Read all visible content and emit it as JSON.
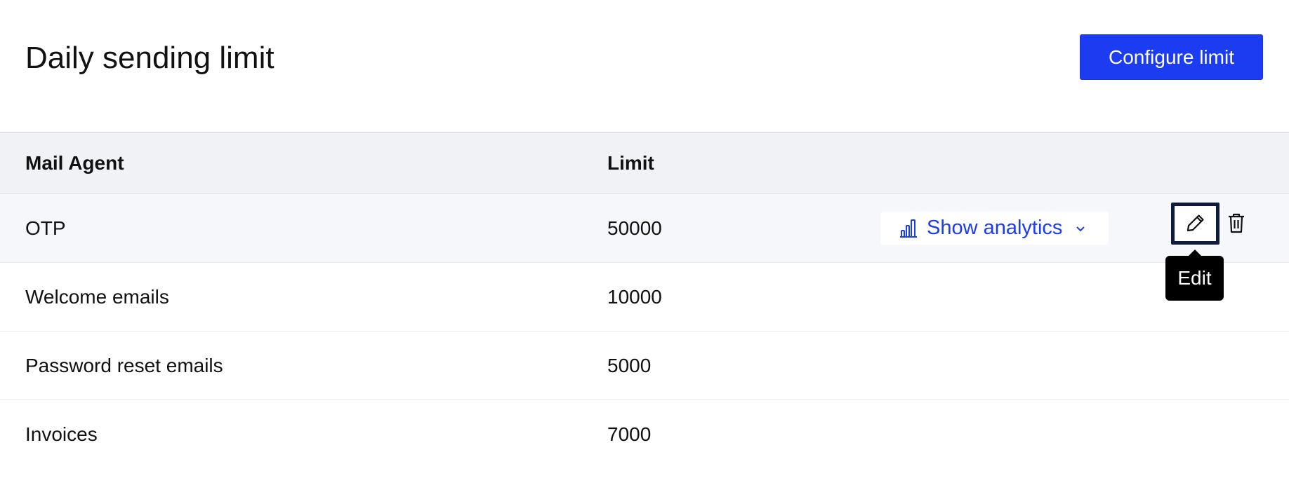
{
  "header": {
    "title": "Daily sending limit",
    "configure_button_label": "Configure limit"
  },
  "colors": {
    "accent": "#1b3cf0",
    "header_bg": "#f1f2f6",
    "hover_row_bg": "#f6f7fa",
    "focus_outline": "#0f1b3d",
    "tooltip_bg": "#000000"
  },
  "table": {
    "columns": [
      "Mail Agent",
      "Limit"
    ],
    "rows": [
      {
        "agent": "OTP",
        "limit": "50000"
      },
      {
        "agent": "Welcome emails",
        "limit": "10000"
      },
      {
        "agent": "Password reset emails",
        "limit": "5000"
      },
      {
        "agent": "Invoices",
        "limit": "7000"
      }
    ],
    "row_actions": {
      "analytics_label": "Show analytics",
      "analytics_icon": "bar-chart-icon",
      "dropdown_icon": "chevron-down-icon",
      "edit_icon": "pencil-icon",
      "delete_icon": "trash-icon"
    }
  },
  "tooltip": {
    "text": "Edit"
  }
}
